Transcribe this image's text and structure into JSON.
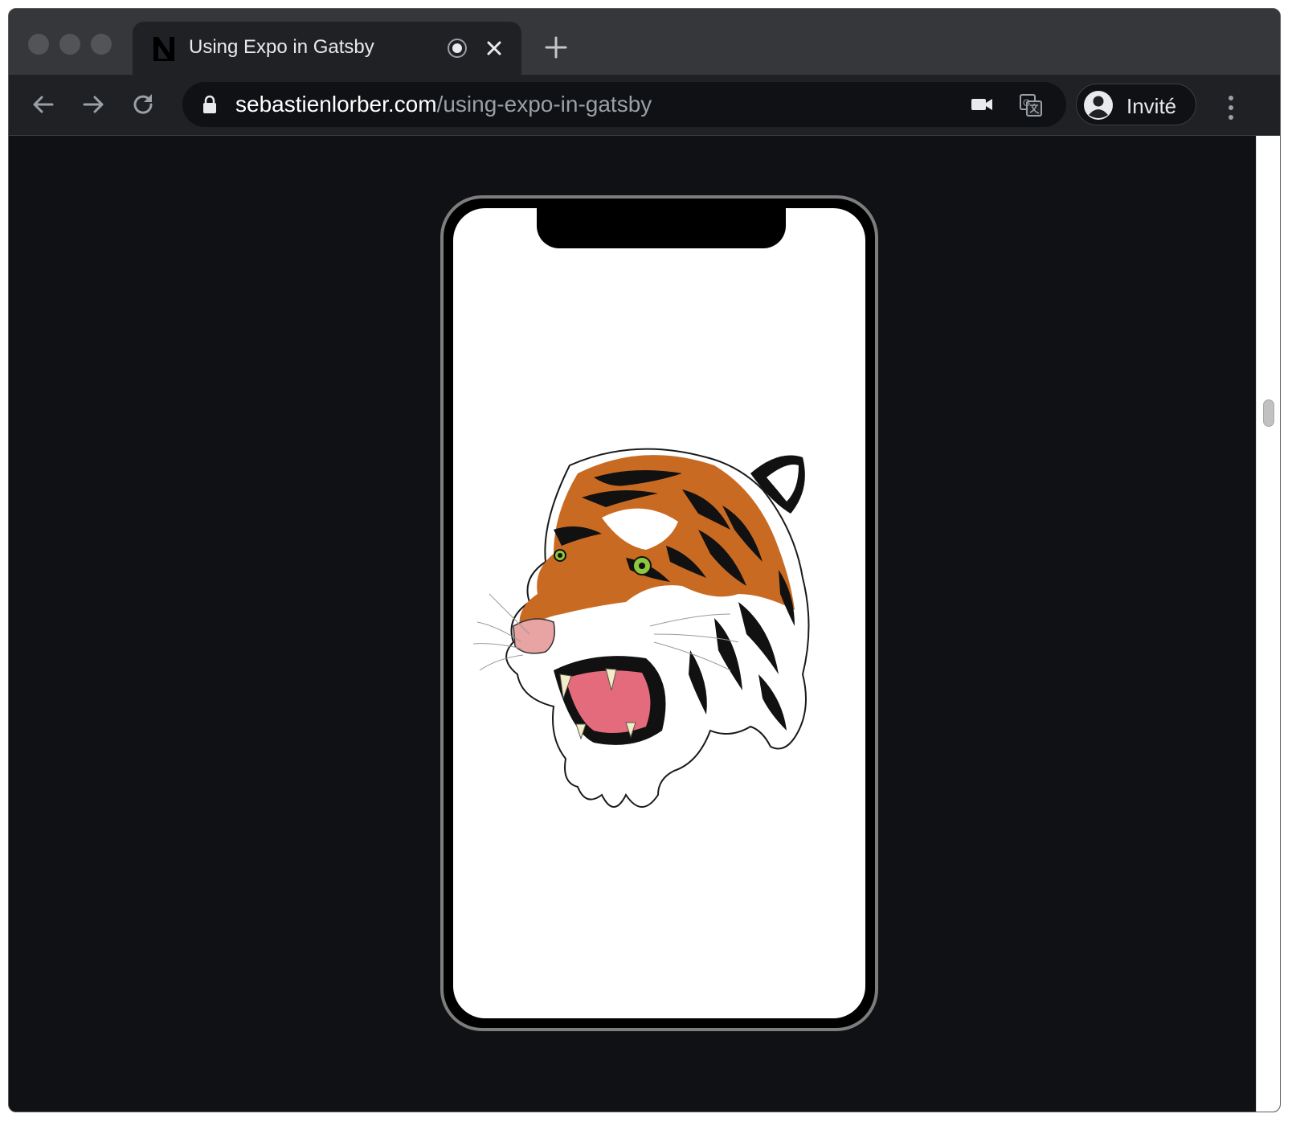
{
  "tab": {
    "title": "Using Expo in Gatsby"
  },
  "address_bar": {
    "host": "sebastienlorber.com",
    "path": "/using-expo-in-gatsby"
  },
  "profile": {
    "label": "Invité"
  },
  "icons": {
    "favicon": "site-logo-icon",
    "record": "media-recording-icon",
    "close": "close-icon",
    "new_tab": "plus-icon",
    "back": "back-arrow-icon",
    "forward": "forward-arrow-icon",
    "reload": "reload-icon",
    "lock": "lock-icon",
    "camera": "camera-icon",
    "translate": "translate-icon",
    "avatar": "account-icon",
    "menu": "kebab-menu-icon"
  },
  "colors": {
    "chrome_dark": "#35373b",
    "toolbar": "#1f2124",
    "page_bg": "#0f1114",
    "tiger_orange": "#c96a22",
    "tiger_eye": "#8dc63f"
  }
}
